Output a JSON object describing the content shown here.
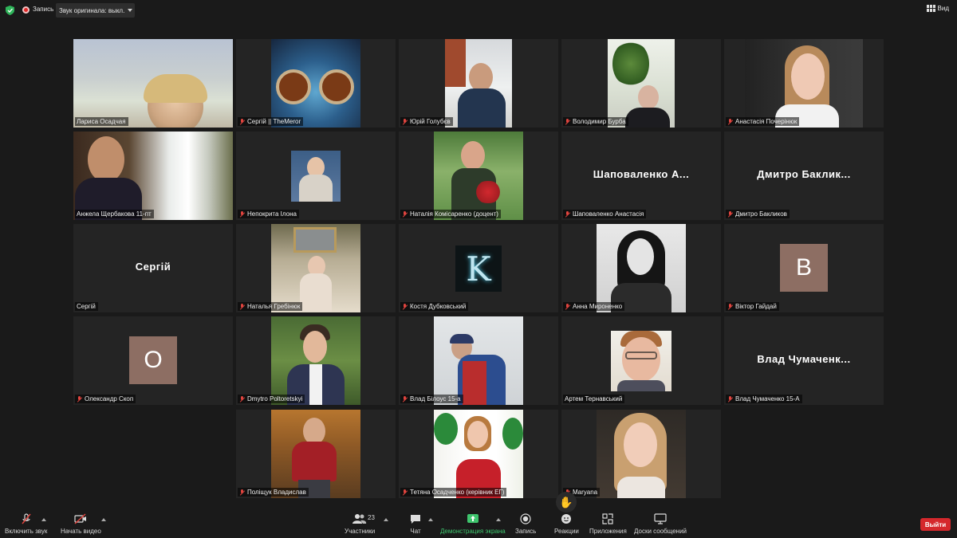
{
  "top_bar": {
    "record_label": "Запись",
    "original_sound_label": "Звук оригинала: выкл.",
    "view_label": "Вид"
  },
  "participants": [
    {
      "name": "Лариса Осадчая"
    },
    {
      "name": "Сергій || TheMeror"
    },
    {
      "name": "Юрій Голубєв"
    },
    {
      "name": "Володимир Бурба"
    },
    {
      "name": "Анастасія Почерінюк"
    },
    {
      "name": "Анжела Щербакова  11-пт"
    },
    {
      "name": "Непокрита Ілона"
    },
    {
      "name": "Наталія Комісаренко (доцент)"
    },
    {
      "name": "Шаповаленко Анастасія",
      "display": "Шаповаленко  А..."
    },
    {
      "name": "Дмитро Бакликов",
      "display": "Дмитро  Баклик..."
    },
    {
      "name": "Сергій",
      "display": "Сергій"
    },
    {
      "name": "Наталья Гребінюк"
    },
    {
      "name": "Костя Дубковський",
      "display": "K"
    },
    {
      "name": "Анна Мироненко"
    },
    {
      "name": "Віктор Гайдай",
      "display": "В"
    },
    {
      "name": "Олександр Скоп",
      "display": "О"
    },
    {
      "name": "Dmytro Poltoretskyi"
    },
    {
      "name": "Влад Білоус 15-а"
    },
    {
      "name": "Артем Тернавський"
    },
    {
      "name": "Влад Чумаченко 15-А",
      "display": "Влад  Чумаченк..."
    },
    {
      "name": "Поліщук Владислав"
    },
    {
      "name": "Тетяна Осадченко (керівник ЕГ)"
    },
    {
      "name": "Maryana"
    }
  ],
  "toolbar": {
    "unmute": "Включить звук",
    "start_video": "Начать видео",
    "participants": "Участники",
    "participants_count": "23",
    "chat": "Чат",
    "share_screen": "Демонстрация экрана",
    "record": "Запись",
    "reactions": "Реакции",
    "apps": "Приложения",
    "whiteboards": "Доски сообщений",
    "leave": "Выйти"
  },
  "colors": {
    "active_speaker": "#c7e05a",
    "share_green": "#3ec46d",
    "leave_red": "#d5282c",
    "avatar_v": "#8d6e63",
    "avatar_o": "#8d6e63"
  }
}
